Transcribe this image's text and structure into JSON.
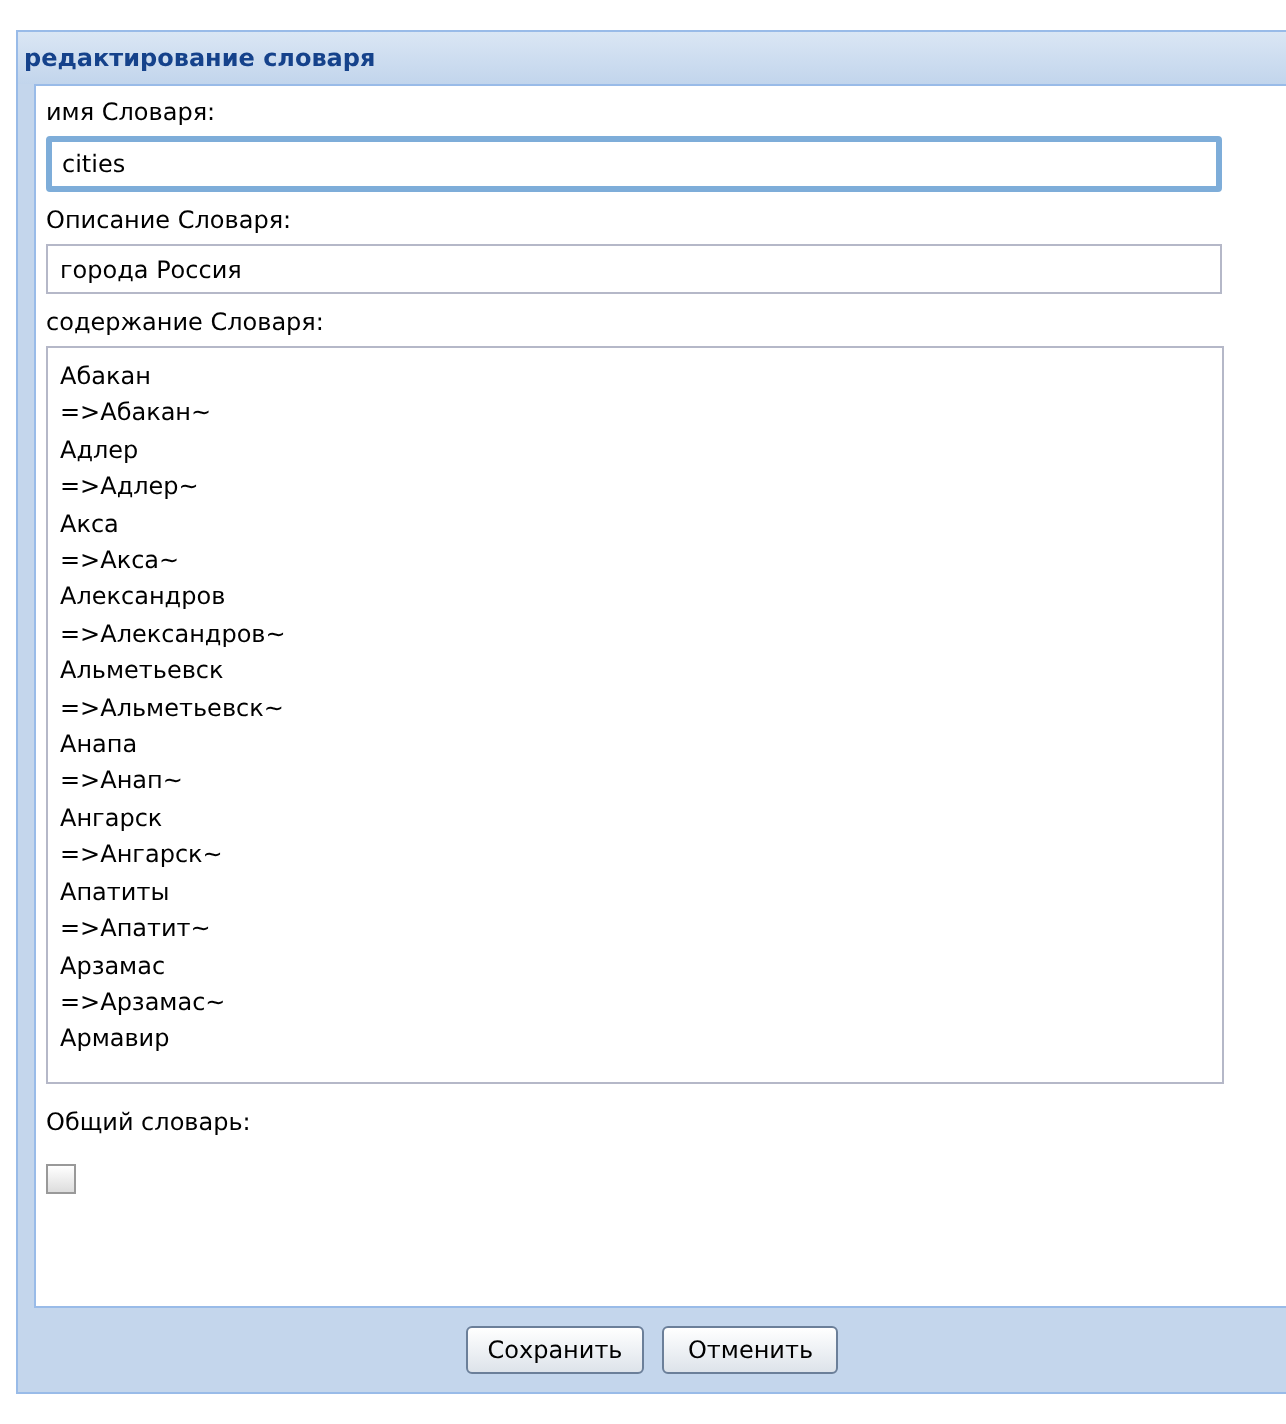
{
  "dialog": {
    "title": "редактирование словаря"
  },
  "name_field": {
    "label": "имя Словаря:",
    "value": "cities",
    "focused": true
  },
  "description_field": {
    "label": "Описание Словаря:",
    "value": "города Россия"
  },
  "content_field": {
    "label": "содержание Словаря:",
    "lines": [
      "Абакан",
      "=>Абакан~",
      "Адлер",
      "=>Адлер~",
      "Акса",
      "=>Акса~",
      "Александров",
      "=>Александров~",
      "Альметьевск",
      "=>Альметьевск~",
      "Анапа",
      "=>Анап~",
      "Ангарск",
      "=>Ангарск~",
      "Апатиты",
      "=>Апатит~",
      "Арзамас",
      "=>Арзамас~",
      "Армавир"
    ]
  },
  "shared": {
    "label": "Общий словарь:",
    "checked": false
  },
  "buttons": [
    "Сохранить",
    "Отменить"
  ]
}
